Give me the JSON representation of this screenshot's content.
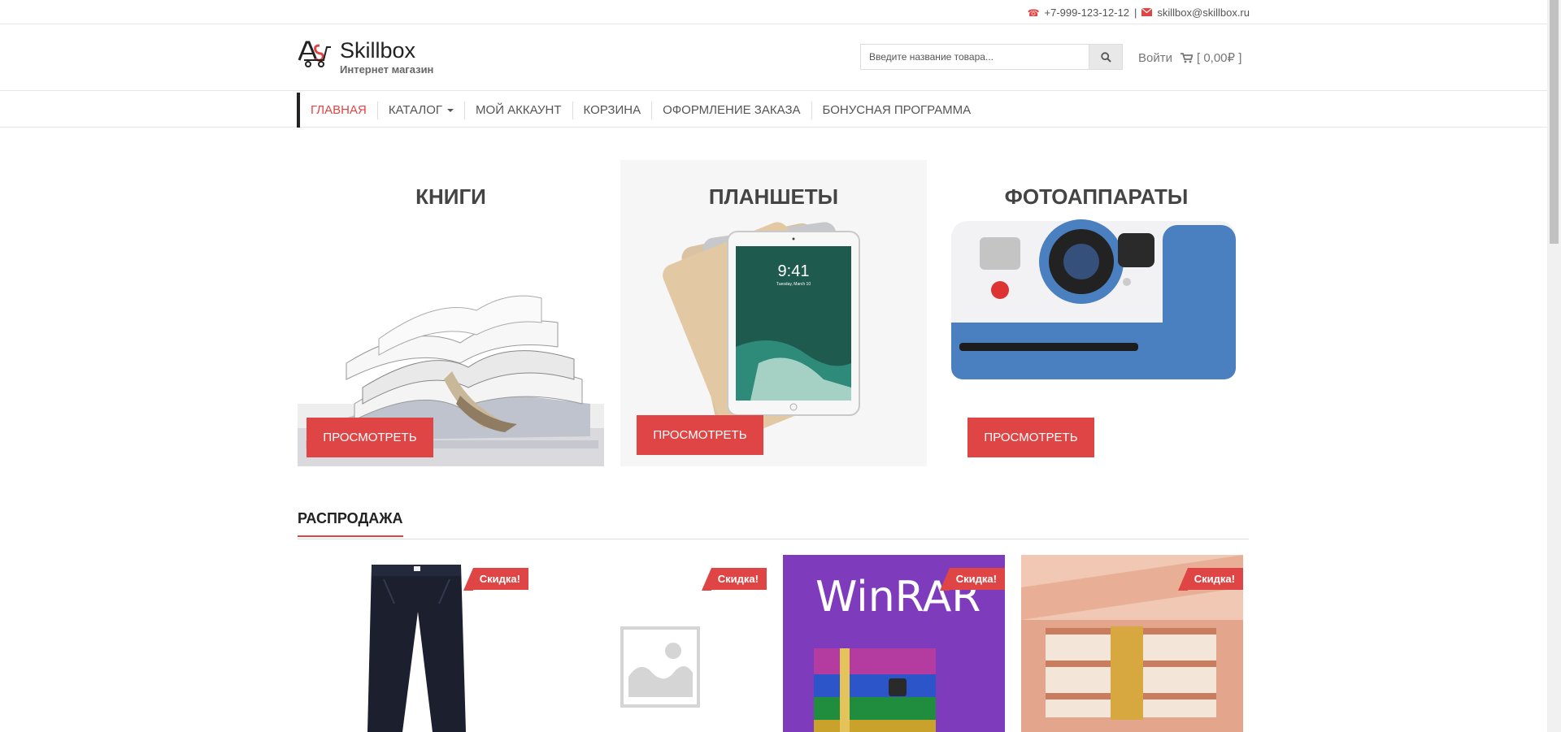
{
  "topbar": {
    "phone": "+7-999-123-12-12",
    "separator": "|",
    "email": "skillbox@skillbox.ru"
  },
  "header": {
    "logo_name": "Skillbox",
    "logo_tagline": "Интернет магазин",
    "search_placeholder": "Введите название товара...",
    "login_label": "Войти",
    "cart_label": "[ 0,00₽ ]"
  },
  "nav": {
    "items": [
      {
        "label": "Главная",
        "active": true
      },
      {
        "label": "Каталог",
        "has_dropdown": true
      },
      {
        "label": "Мой аккаунт"
      },
      {
        "label": "Корзина"
      },
      {
        "label": "Оформление заказа"
      },
      {
        "label": "Бонусная программа"
      }
    ]
  },
  "categories": [
    {
      "title": "КНИГИ",
      "button": "ПРОСМОТРЕТЬ"
    },
    {
      "title": "ПЛАНШЕТЫ",
      "button": "ПРОСМОТРЕТЬ",
      "tablet_time": "9:41",
      "tablet_date": "Tuesday, March 10"
    },
    {
      "title": "ФОТОАППАРАТЫ",
      "button": "ПРОСМОТРЕТЬ"
    }
  ],
  "sale": {
    "title": "РАСПРОДАЖА",
    "products": [
      {
        "badge": "Скидка!"
      },
      {
        "badge": "Скидка!"
      },
      {
        "badge": "Скидка!",
        "image_text": "WinRAR"
      },
      {
        "badge": "Скидка!"
      }
    ]
  },
  "colors": {
    "accent": "#e04545",
    "text": "#444444",
    "border": "#e6e6e6"
  }
}
